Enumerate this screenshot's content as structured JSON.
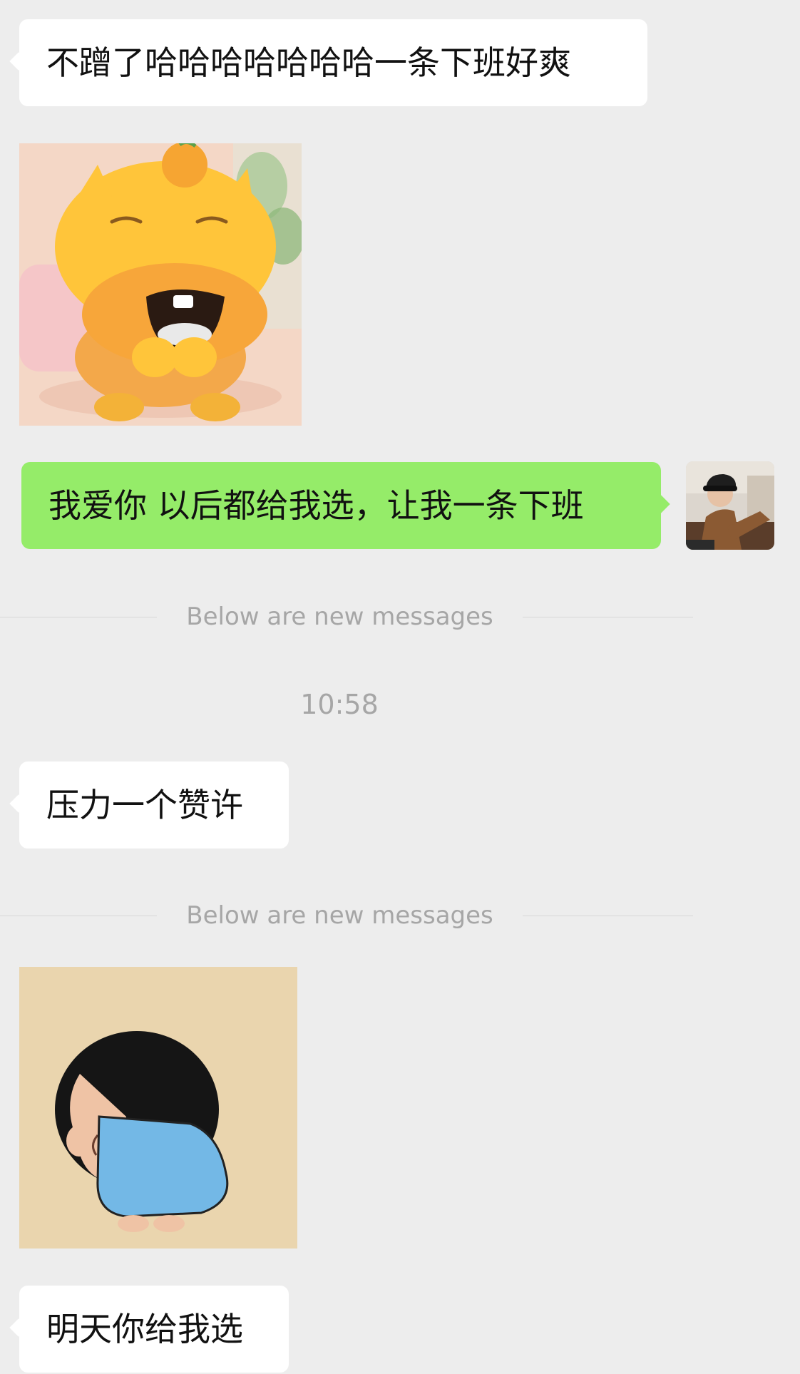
{
  "chat": {
    "messages": [
      {
        "sender": "other",
        "type": "text",
        "text": "不蹭了哈哈哈哈哈哈哈一条下班好爽"
      },
      {
        "sender": "other",
        "type": "sticker",
        "icon": "laughing-yellow-cartoon-sticker"
      },
      {
        "sender": "self",
        "type": "text",
        "text": "我爱你 以后都给我选，让我一条下班",
        "avatar_icon": "user-avatar-photo"
      },
      {
        "type": "divider",
        "text": "Below are new messages"
      },
      {
        "type": "timestamp",
        "text": "10:58"
      },
      {
        "sender": "other",
        "type": "text",
        "text": "压力一个赞许"
      },
      {
        "type": "divider",
        "text": "Below are new messages"
      },
      {
        "sender": "other",
        "type": "sticker",
        "icon": "shinchan-walking-sticker"
      },
      {
        "sender": "other",
        "type": "text",
        "text": "明天你给我选"
      }
    ]
  },
  "colors": {
    "background": "#EDEDED",
    "incoming_bubble": "#FFFFFF",
    "outgoing_bubble": "#95EC69",
    "divider_text": "#A6A6A6"
  }
}
